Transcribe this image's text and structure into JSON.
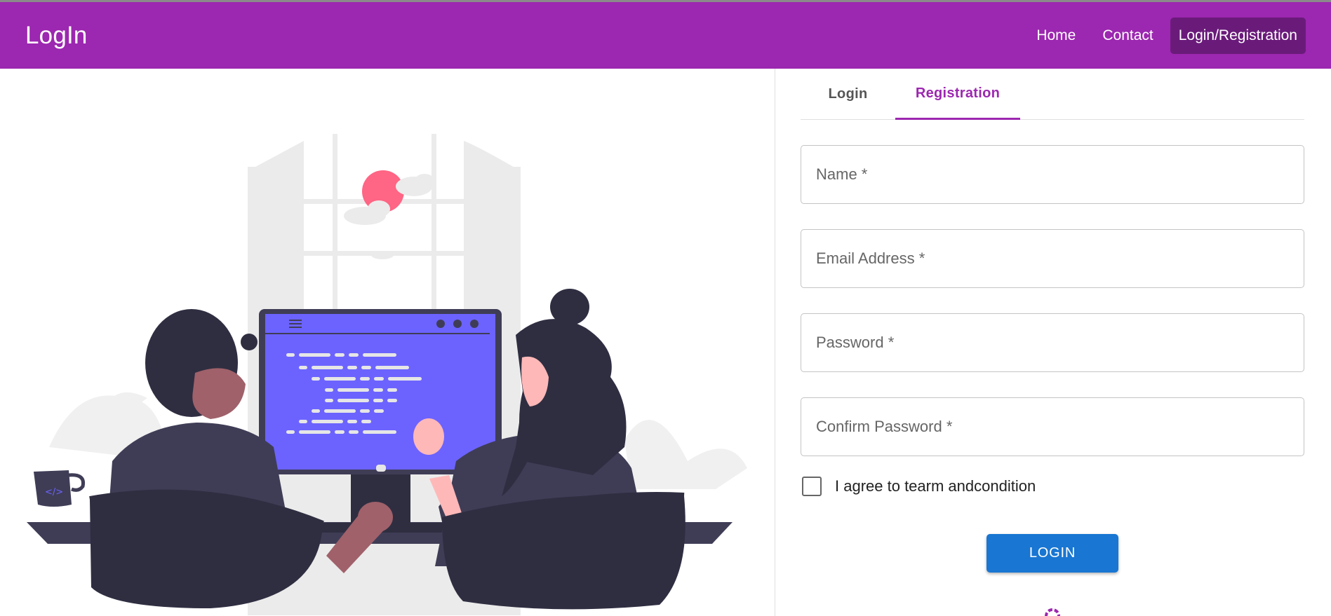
{
  "appbar": {
    "brand": "LogIn",
    "nav": [
      "Home",
      "Contact",
      "Login/Registration"
    ]
  },
  "tabs": [
    "Login",
    "Registration"
  ],
  "form": {
    "name_label": "Name *",
    "email_label": "Email Address *",
    "password_label": "Password *",
    "confirm_label": "Confirm Password *",
    "agree_label": "I agree to tearm andcondition",
    "submit_label": "LOGIN"
  },
  "colors": {
    "primary": "#9c27b0",
    "button": "#1976d2",
    "active_nav": "#6a1b7a"
  },
  "illustration": {
    "name": "two-people-coding-illustration",
    "accent": "#6c63ff"
  }
}
